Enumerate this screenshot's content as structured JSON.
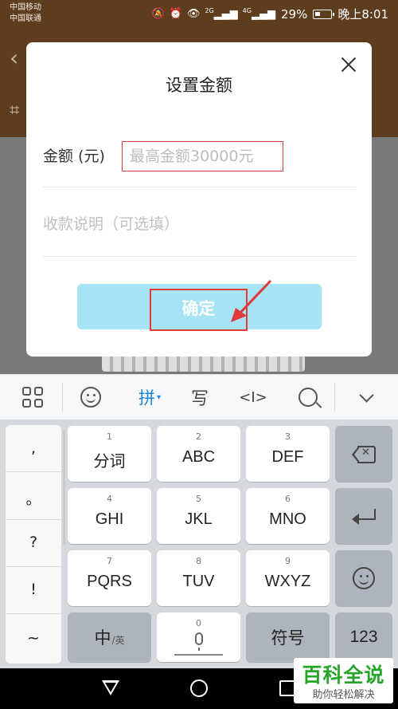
{
  "status_bar": {
    "carrier1": "中国移动",
    "carrier2": "中国联通",
    "net1": "2G",
    "net2": "4G",
    "battery": "29%",
    "time": "晚上8:01"
  },
  "dialog": {
    "title": "设置金额",
    "amount_label": "金额 (元)",
    "amount_placeholder": "最高金额30000元",
    "note_placeholder": "收款说明（可选填）",
    "confirm_label": "确定",
    "confirm_color": "#a6e3f4",
    "highlight_color": "#e23a3a"
  },
  "keyboard_toolbar": {
    "pinyin": "拼",
    "handwrite": "写",
    "cursor": "<I>"
  },
  "keyboard": {
    "punctuation": [
      ",",
      "。",
      "?",
      "!",
      "~"
    ],
    "rows": [
      [
        {
          "num": "1",
          "label": "分词"
        },
        {
          "num": "2",
          "label": "ABC"
        },
        {
          "num": "3",
          "label": "DEF"
        }
      ],
      [
        {
          "num": "4",
          "label": "GHI"
        },
        {
          "num": "5",
          "label": "JKL"
        },
        {
          "num": "6",
          "label": "MNO"
        }
      ],
      [
        {
          "num": "7",
          "label": "PQRS"
        },
        {
          "num": "8",
          "label": "TUV"
        },
        {
          "num": "9",
          "label": "WXYZ"
        }
      ]
    ],
    "lang_main": "中",
    "lang_sub": "/英",
    "space_num": "0",
    "symbol": "符号",
    "num_switch": "123"
  },
  "watermark": {
    "title": "百科全说",
    "subtitle": "助你轻松解决"
  }
}
